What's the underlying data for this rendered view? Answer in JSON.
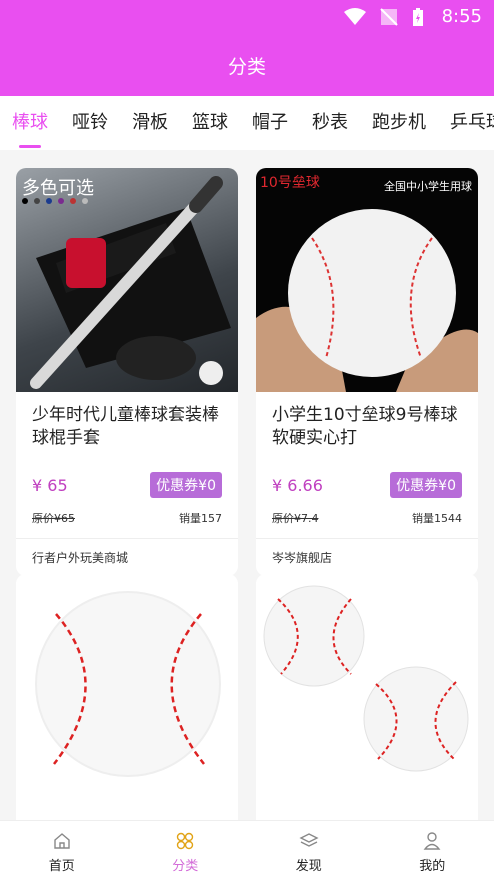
{
  "status": {
    "time": "8:55"
  },
  "header": {
    "title": "分类"
  },
  "tabs": [
    {
      "label": "棒球",
      "active": true
    },
    {
      "label": "哑铃",
      "active": false
    },
    {
      "label": "滑板",
      "active": false
    },
    {
      "label": "篮球",
      "active": false
    },
    {
      "label": "帽子",
      "active": false
    },
    {
      "label": "秒表",
      "active": false
    },
    {
      "label": "跑步机",
      "active": false
    },
    {
      "label": "乒乓球",
      "active": false
    }
  ],
  "products": [
    {
      "image_overlay": "多色可选",
      "title": "少年时代儿童棒球套装棒球棍手套",
      "price": "¥ 65",
      "coupon": "优惠券¥0",
      "original_price": "原价¥65",
      "sales": "销量157",
      "store": "行者户外玩美商城"
    },
    {
      "image_overlay": "10号垒球",
      "image_overlay_right": "全国中小学生用球",
      "title": "小学生10寸垒球9号棒球软硬实心打",
      "price": "¥ 6.66",
      "coupon": "优惠券¥0",
      "original_price": "原价¥7.4",
      "sales": "销量1544",
      "store": "岑岑旗舰店"
    }
  ],
  "bottom_nav": [
    {
      "label": "首页",
      "icon": "home-icon",
      "active": false
    },
    {
      "label": "分类",
      "icon": "category-icon",
      "active": true
    },
    {
      "label": "发现",
      "icon": "layers-icon",
      "active": false
    },
    {
      "label": "我的",
      "icon": "user-icon",
      "active": false
    }
  ],
  "colors": {
    "accent": "#e94ff0",
    "coupon": "#b76cd8"
  }
}
